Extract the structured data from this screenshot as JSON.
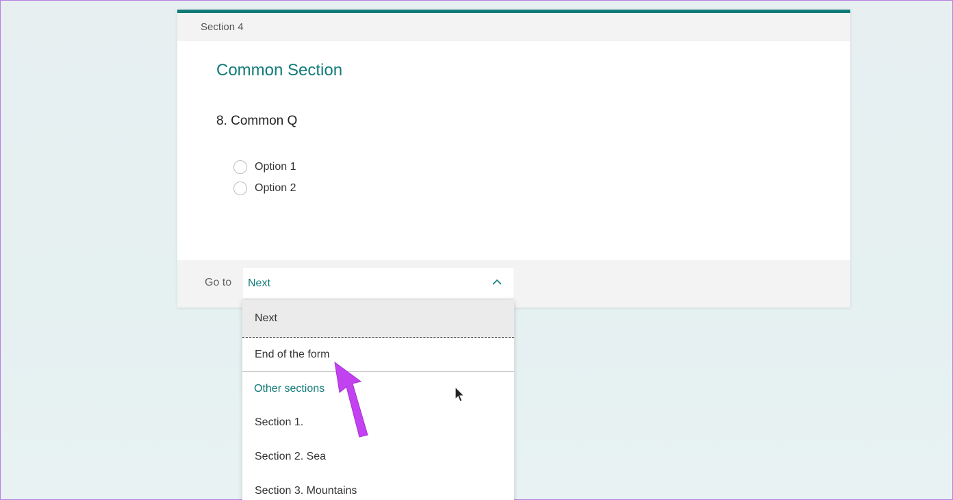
{
  "section": {
    "header": "Section 4",
    "title": "Common Section"
  },
  "question": {
    "text": "8. Common Q",
    "options": [
      "Option 1",
      "Option 2"
    ]
  },
  "goto": {
    "label": "Go to",
    "selected": "Next"
  },
  "dropdown": {
    "items": {
      "next": "Next",
      "end": "End of the form",
      "other_header": "Other sections",
      "s1": "Section 1.",
      "s2": "Section 2. Sea",
      "s3": "Section 3. Mountains"
    }
  },
  "colors": {
    "accent": "#117b79",
    "annotation": "#c242f0"
  },
  "icons": [
    "chevron-up-icon",
    "annotation-arrow-icon",
    "mouse-cursor-icon"
  ]
}
